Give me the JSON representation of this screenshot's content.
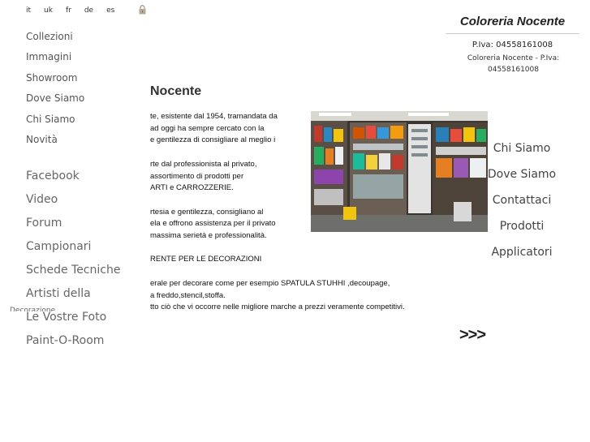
{
  "languages": [
    "it",
    "uk",
    "fr",
    "de",
    "es"
  ],
  "menu": [
    "Collezioni",
    "Immagini",
    "Showroom",
    "Dove Siamo",
    "Chi Siamo",
    "Novità"
  ],
  "menu2": [
    "Facebook",
    "Video",
    "Forum",
    "Campionari",
    "Schede Tecniche",
    "Artisti della",
    "Le Vostre Foto",
    "Paint-O-Room"
  ],
  "artisti_sub": "Decorazione",
  "content": {
    "title": "Nocente",
    "text": "te, esistente dal 1954, tramandata da\nad oggi ha sempre cercato con la\ne gentilezza di consigliare al meglio i\n\nrte dal professionista al privato,\nassortimento di prodotti per\nARTI e CARROZZERIE.\n\nrtesia e gentilezza, consigliano al\nela e offrono assistenza per il privato\nmassima serietà e professionalità.\n\nRENTE PER LE DECORAZIONI\n\nerale per decorare come per esempio SPATULA STUHHI ,decoupage,\na freddo,stencil,stoffa.\ntto ciò che vi occorre nelle migliore marche a prezzi veramente competitivi."
  },
  "brand": {
    "title": "Coloreria Nocente",
    "piva": "P.Iva: 04558161008",
    "piva2": "Coloreria Nocente - P.Iva: 04558161008"
  },
  "right_nav": [
    "Chi Siamo",
    "Dove Siamo",
    "Contattaci",
    "Prodotti",
    "Applicatori"
  ],
  "next_label": ">>>",
  "colors": {
    "text": "#222222",
    "menu": "#555555",
    "accent_rule": "#cccccc"
  }
}
